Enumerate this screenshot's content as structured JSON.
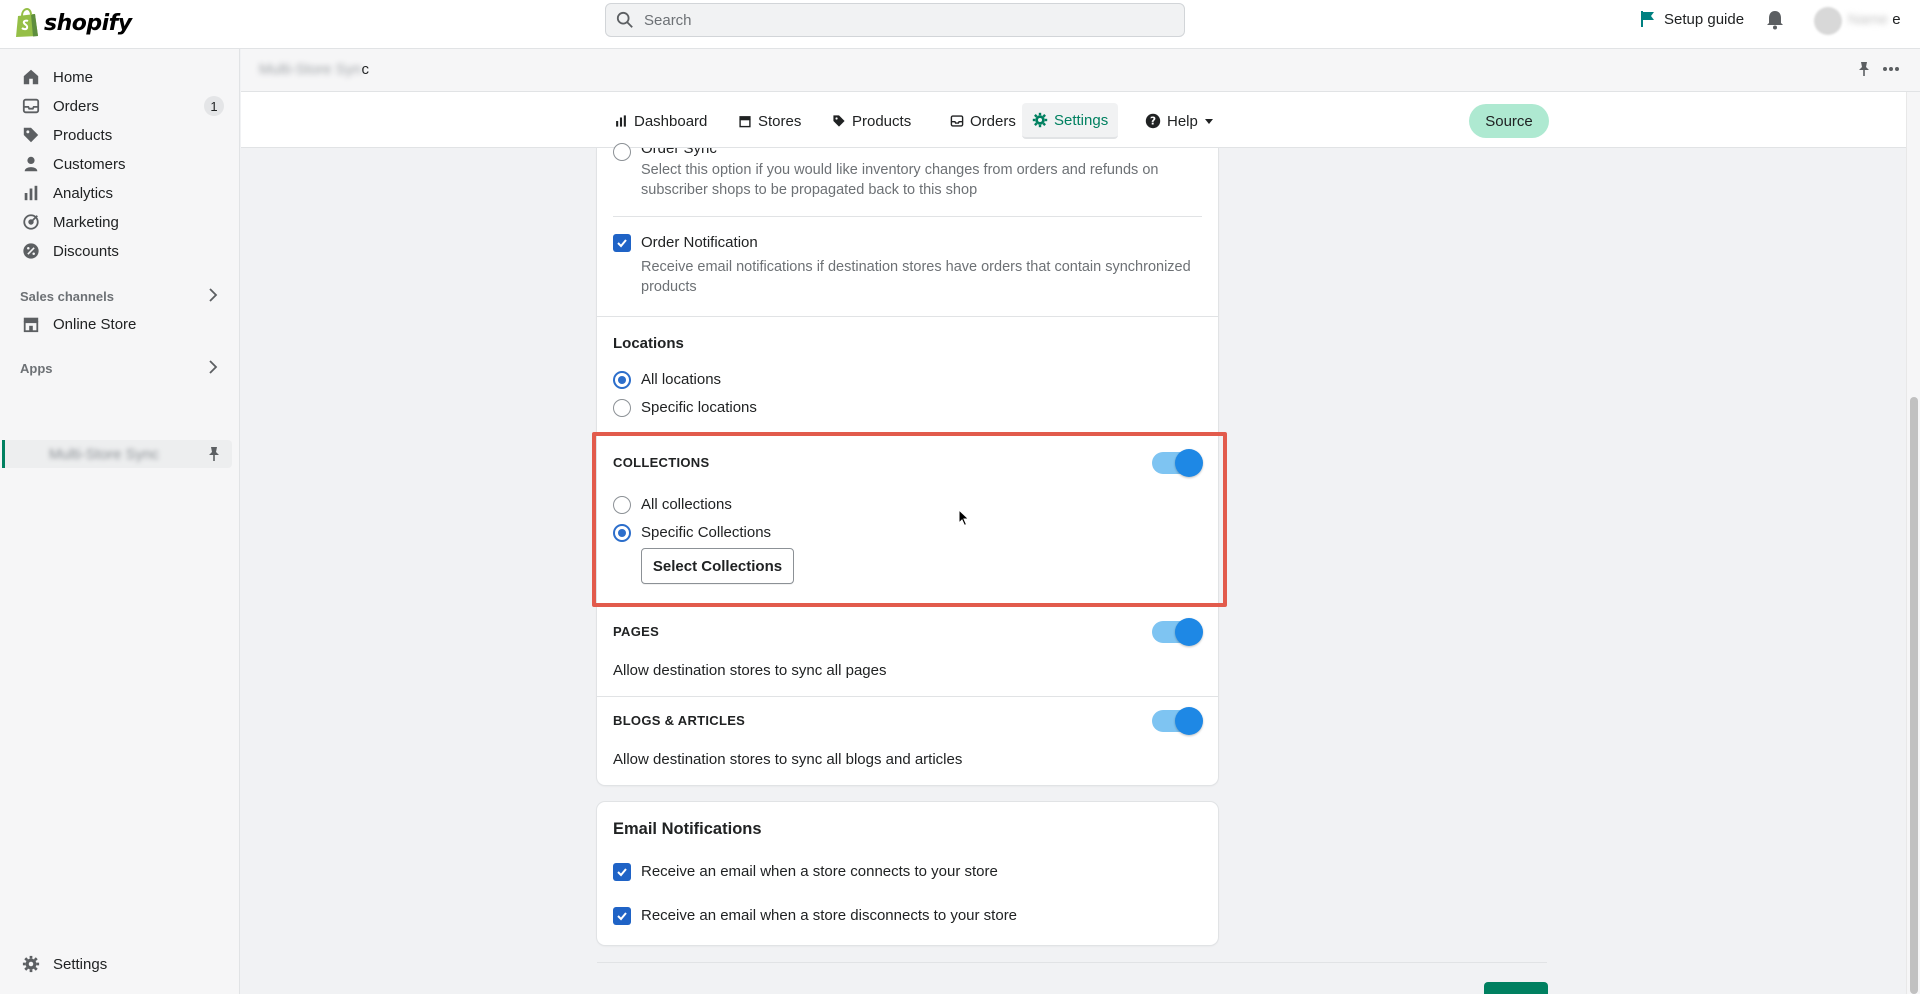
{
  "topbar": {
    "logo_text": "shopify",
    "search_placeholder": "Search",
    "setup_guide": "Setup guide",
    "user_name_suffix": "e"
  },
  "sidebar": {
    "items": [
      {
        "label": "Home",
        "icon": "home-icon"
      },
      {
        "label": "Orders",
        "icon": "orders-icon",
        "badge": "1"
      },
      {
        "label": "Products",
        "icon": "tag-icon"
      },
      {
        "label": "Customers",
        "icon": "person-icon"
      },
      {
        "label": "Analytics",
        "icon": "bar-chart-icon"
      },
      {
        "label": "Marketing",
        "icon": "target-icon"
      },
      {
        "label": "Discounts",
        "icon": "discount-icon"
      }
    ],
    "sales_channels_label": "Sales channels",
    "online_store": "Online Store",
    "apps_label": "Apps",
    "settings": "Settings"
  },
  "app_header": {
    "title_suffix": "c"
  },
  "app_nav": {
    "items": [
      {
        "label": "Dashboard",
        "icon": "bar-chart-icon"
      },
      {
        "label": "Stores",
        "icon": "store-icon"
      },
      {
        "label": "Products",
        "icon": "tag-icon"
      },
      {
        "label": "Orders",
        "icon": "inbox-icon"
      },
      {
        "label": "Settings",
        "icon": "gear-icon",
        "active": true
      },
      {
        "label": "Help",
        "icon": "question-icon"
      }
    ],
    "source_label": "Source"
  },
  "main": {
    "order_sync_label": "Order Sync",
    "order_sync_desc_1": "Select this option if you would like inventory changes from orders and refunds on",
    "order_sync_desc_2": "subscriber shops to be propagated back to this shop",
    "order_notification_label": "Order Notification",
    "order_notification_desc_1": "Receive email notifications if destination stores have orders that contain synchronized",
    "order_notification_desc_2": "products",
    "locations_title": "Locations",
    "all_locations": "All locations",
    "specific_locations": "Specific locations",
    "collections_title": "COLLECTIONS",
    "all_collections": "All collections",
    "specific_collections": "Specific Collections",
    "select_collections_button": "Select Collections",
    "pages_title": "PAGES",
    "pages_desc": "Allow destination stores to sync all pages",
    "blogs_title": "BLOGS & ARTICLES",
    "blogs_desc": "Allow destination stores to sync all blogs and articles"
  },
  "email": {
    "title": "Email Notifications",
    "connects": "Receive an email when a store connects to your store",
    "disconnects": "Receive an email when a store disconnects to your store"
  },
  "colors": {
    "brand_green": "#008060",
    "checkbox_blue": "#1f63c6",
    "toggle_blue": "#1e88e5",
    "highlight_red": "#e25b4c"
  }
}
